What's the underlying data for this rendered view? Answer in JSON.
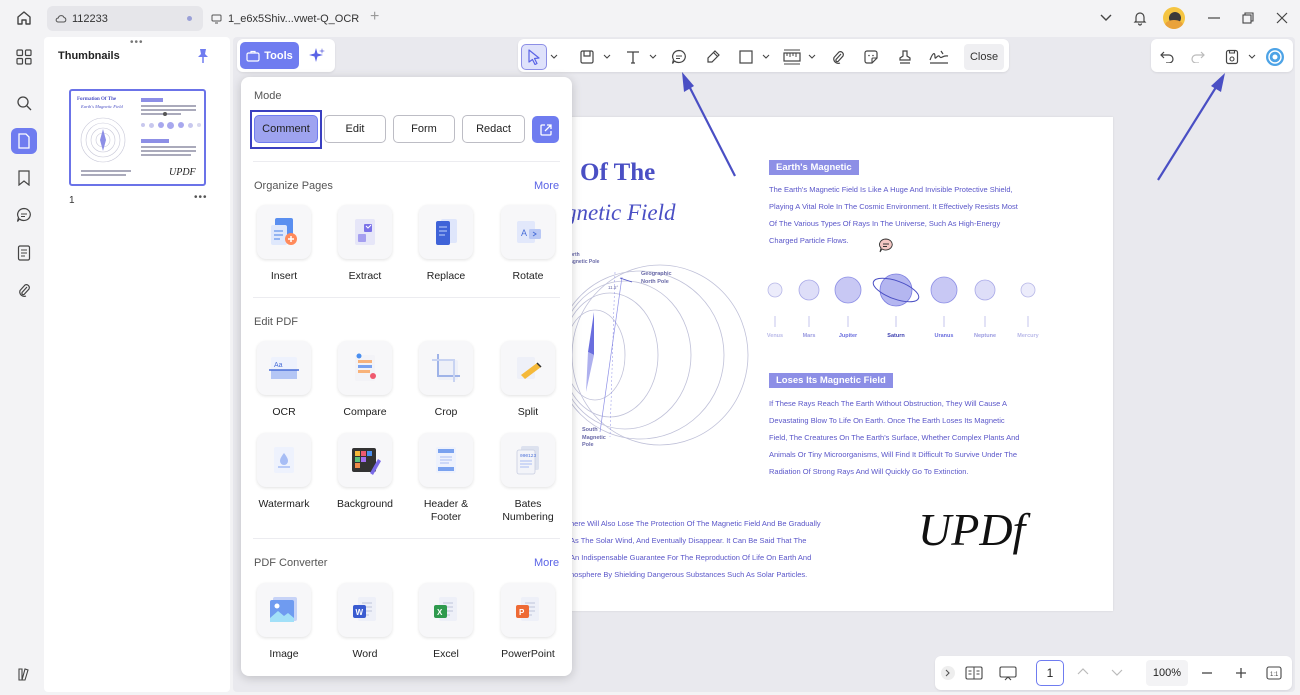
{
  "titlebar": {
    "tabs": [
      {
        "label": "112233",
        "icon": "cloud-icon"
      },
      {
        "label": "1_e6x5Shiv...vwet-Q_OCR",
        "icon": "monitor-icon"
      }
    ],
    "new_tab": "+"
  },
  "sidebar": {
    "title": "Thumbnails",
    "page_number": "1",
    "thumb_title_1": "Formation Of The",
    "thumb_title_2": "Earth's Magnetic Field",
    "thumb_logo": "UPDF"
  },
  "toolbar": {
    "tools_label": "Tools",
    "close_label": "Close"
  },
  "tools_panel": {
    "mode_label": "Mode",
    "modes": [
      "Comment",
      "Edit",
      "Form",
      "Redact"
    ],
    "organize_label": "Organize Pages",
    "organize_more": "More",
    "organize_items": [
      "Insert",
      "Extract",
      "Replace",
      "Rotate"
    ],
    "edit_label": "Edit PDF",
    "edit_items": [
      "OCR",
      "Compare",
      "Crop",
      "Split",
      "Watermark",
      "Background",
      "Header & Footer",
      "Bates Numbering"
    ],
    "converter_label": "PDF Converter",
    "converter_more": "More",
    "converter_items": [
      "Image",
      "Word",
      "Excel",
      "PowerPoint"
    ]
  },
  "document": {
    "title_line1": "Of The",
    "title_line2": "gnetic Field",
    "section1_tag": "Earth's Magnetic",
    "section1_text": [
      "The Earth's Magnetic Field Is Like A Huge And Invisible Protective Shield,",
      "Playing A Vital Role In The Cosmic Environment. It Effectively Resists Most",
      "Of The Various Types Of Rays In The Universe, Such As High-Energy",
      "Charged Particle Flows."
    ],
    "planets": [
      "Venus",
      "Mars",
      "Jupiter",
      "Saturn",
      "Uranus",
      "Neptune",
      "Mercury"
    ],
    "section2_tag": "Loses Its Magnetic Field",
    "section2_text": [
      "If These Rays Reach The Earth Without Obstruction, They Will Cause A",
      "Devastating Blow To Life On Earth. Once The Earth Loses Its Magnetic",
      "Field, The Creatures On The Earth's Surface, Whether Complex Plants And",
      "Animals Or Tiny Microorganisms, Will Find It Difficult To Survive Under The",
      "Radiation Of Strong Rays And Will Quickly Go To Extinction."
    ],
    "bottom_text": [
      "here Will Also Lose The Protection Of The Magnetic Field And Be Gradually",
      "As The Solar Wind, And Eventually Disappear. It Can Be Said That The",
      "An Indispensable Guarantee For The Reproduction Of Life On Earth And",
      "nosphere By Shielding Dangerous Substances Such As Solar Particles."
    ],
    "diagram_labels": {
      "north_mag": "orth\nagnetic Pole",
      "geo_north": "Geographic\nNorth Pole",
      "angle": "11.5°",
      "south_mag": "South\nMagnetic\nPole"
    },
    "logo": "UPDf"
  },
  "bottombar": {
    "page_input": "1",
    "zoom": "100%"
  },
  "colors": {
    "accent": "#6f7cf0",
    "doc_purple": "#5a56c9",
    "tag_bg": "#8d8fe6",
    "annotation_arrow": "#4a4fc4"
  }
}
